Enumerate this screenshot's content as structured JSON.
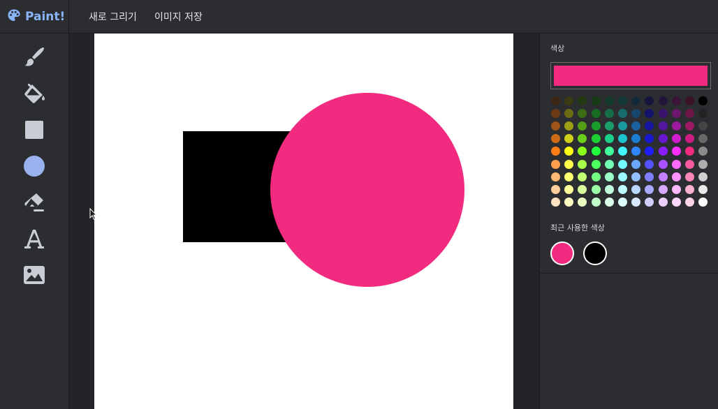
{
  "app": {
    "name": "Paint!"
  },
  "menu": {
    "new_drawing": "새로 그리기",
    "save_image": "이미지 저장"
  },
  "tools": [
    {
      "name": "brush-tool",
      "icon": "brush-icon"
    },
    {
      "name": "fill-tool",
      "icon": "paint-bucket-icon"
    },
    {
      "name": "rectangle-tool",
      "icon": "square-icon"
    },
    {
      "name": "circle-tool",
      "icon": "circle-icon",
      "active": true
    },
    {
      "name": "eraser-tool",
      "icon": "eraser-icon"
    },
    {
      "name": "text-tool",
      "icon": "text-icon"
    },
    {
      "name": "image-tool",
      "icon": "image-icon"
    }
  ],
  "canvas": {
    "shapes": [
      {
        "type": "rectangle",
        "color": "#000000"
      },
      {
        "type": "circle",
        "color": "#f22a80"
      }
    ]
  },
  "color_panel": {
    "title": "색상",
    "current_color": "#f22a80",
    "recent_title": "최근 사용한 색상",
    "recent_colors": [
      "#f22a80",
      "#000000"
    ],
    "palette": [
      [
        "#3b2515",
        "#3a3a13",
        "#233a13",
        "#143a16",
        "#143a2b",
        "#13393a",
        "#142a3a",
        "#13163a",
        "#23143a",
        "#3a1439",
        "#3a1425",
        "#000000"
      ],
      [
        "#6c3b13",
        "#6c6c13",
        "#3b6c13",
        "#176c20",
        "#176c4a",
        "#176b6c",
        "#17456c",
        "#13136c",
        "#3b136c",
        "#6c176c",
        "#6c1746",
        "#232323"
      ],
      [
        "#9e5416",
        "#9e9e16",
        "#549e16",
        "#199e2a",
        "#199e6a",
        "#19999e",
        "#19619e",
        "#16169e",
        "#54169e",
        "#9e199e",
        "#9e1964",
        "#454545"
      ],
      [
        "#cf6a18",
        "#cfcf18",
        "#6acf18",
        "#1ccf33",
        "#1ccf89",
        "#1cc4cf",
        "#1c7ccf",
        "#1818cf",
        "#6a18cf",
        "#cf1ccf",
        "#cf1c81",
        "#686868"
      ],
      [
        "#ff7f16",
        "#ffff16",
        "#8bff16",
        "#20ff3d",
        "#41ff9b",
        "#41f5ff",
        "#2f86ff",
        "#1e1eff",
        "#8b1eff",
        "#ff2fff",
        "#f22a80",
        "#8b8b8b"
      ],
      [
        "#ff9f4b",
        "#ffff4b",
        "#aaff4b",
        "#4bff5f",
        "#73ffb3",
        "#73f8ff",
        "#6aa7ff",
        "#5252ff",
        "#aa52ff",
        "#ff6aff",
        "#f55a9f",
        "#aeaeae"
      ],
      [
        "#ffb873",
        "#ffff73",
        "#c4ff73",
        "#73ff82",
        "#9bffc8",
        "#9bfaff",
        "#94c0ff",
        "#8080ff",
        "#c480ff",
        "#ff94ff",
        "#f888b8",
        "#d1d1d1"
      ],
      [
        "#ffcf9b",
        "#ffff9b",
        "#d8ff9b",
        "#9bffa5",
        "#bfffdb",
        "#bffcff",
        "#b9d7ff",
        "#aaaaff",
        "#d8aaff",
        "#ffb9ff",
        "#fbb2d0",
        "#e8e8e8"
      ],
      [
        "#ffe3c3",
        "#ffffc3",
        "#ebffc3",
        "#c3ffc9",
        "#dcffeb",
        "#dcfeff",
        "#d7e8ff",
        "#d0d0ff",
        "#ebd0ff",
        "#ffd7ff",
        "#fdd4e6",
        "#ffffff"
      ]
    ]
  }
}
